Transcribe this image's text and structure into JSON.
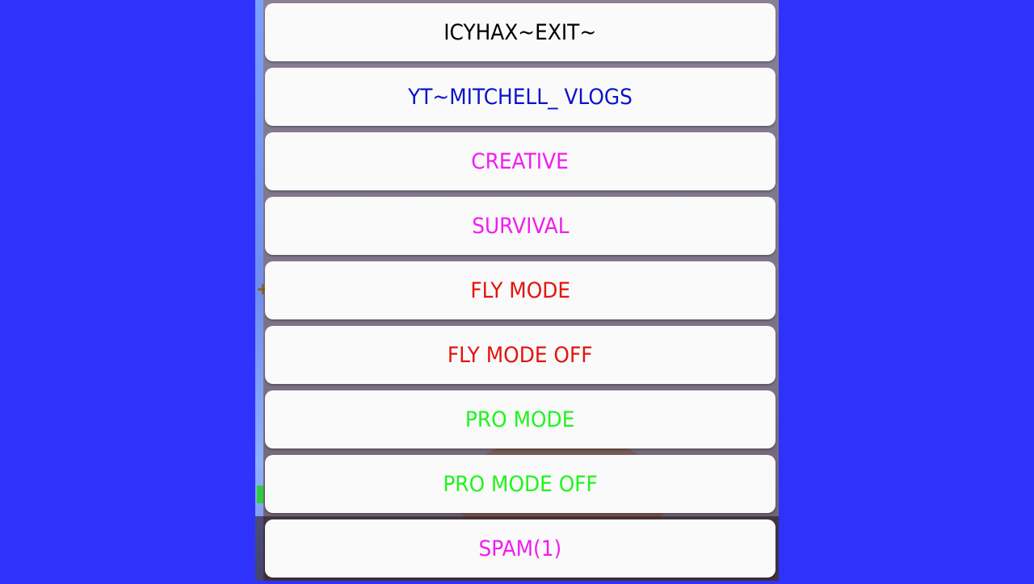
{
  "menu": {
    "items": [
      {
        "label": "ICYHAX~EXIT~",
        "color": "#000000"
      },
      {
        "label": "YT~MITCHELL_ VLOGS",
        "color": "#0b13c9"
      },
      {
        "label": "CREATIVE",
        "color": "#f21cf0"
      },
      {
        "label": "SURVIVAL",
        "color": "#f21cf0"
      },
      {
        "label": "FLY MODE",
        "color": "#e3140e"
      },
      {
        "label": "FLY MODE OFF",
        "color": "#e3140e"
      },
      {
        "label": "PRO MODE",
        "color": "#1ef51a"
      },
      {
        "label": "PRO MODE OFF",
        "color": "#1ef51a"
      },
      {
        "label": "SPAM(1)",
        "color": "#f21cf0"
      }
    ]
  },
  "colors": {
    "page_background": "#2f32fb",
    "button_background": "#fafafa"
  }
}
